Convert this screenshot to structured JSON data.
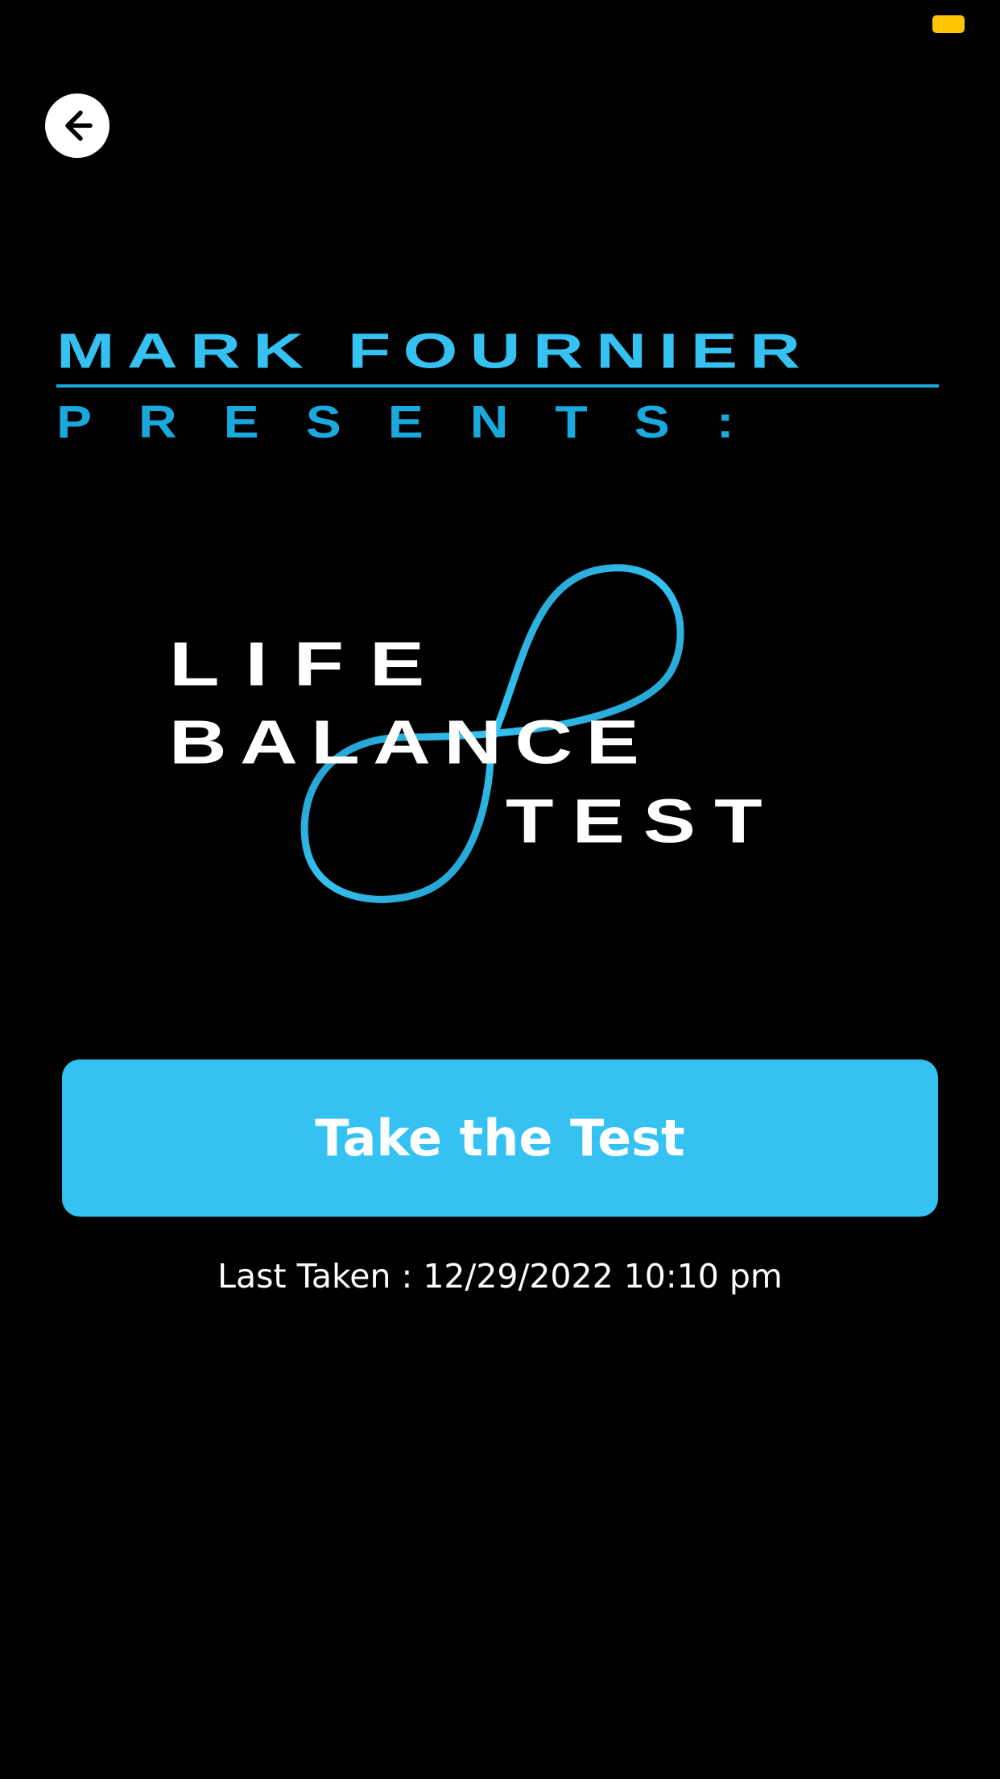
{
  "colors": {
    "background": "#000000",
    "accent": "#35c2f2",
    "brand_blue": "#19a9dc",
    "status_indicator": "#ffc400",
    "text": "#ffffff"
  },
  "header": {
    "back_icon": "arrow-left-icon"
  },
  "brand": {
    "presenter_name": "MARK FOURNIER",
    "presents": "PRESENTS:"
  },
  "logo": {
    "line1": "LIFE",
    "line2": "BALANCE",
    "line3": "TEST",
    "symbol": "infinity-loop-icon"
  },
  "main": {
    "cta_label": "Take the Test",
    "last_taken": "Last Taken : 12/29/2022 10:10 pm"
  }
}
